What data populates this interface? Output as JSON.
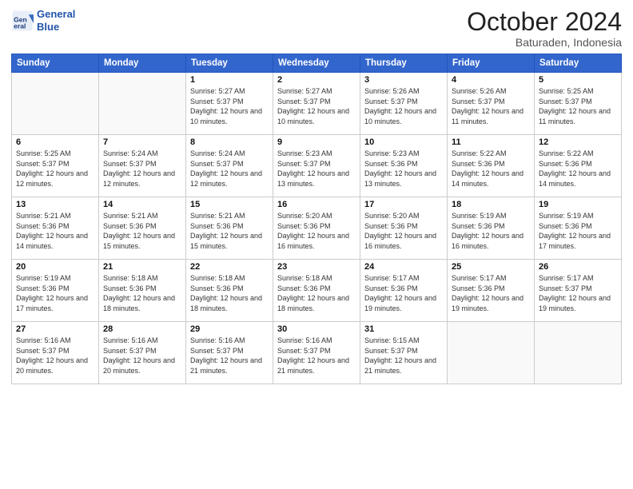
{
  "logo": {
    "line1": "General",
    "line2": "Blue"
  },
  "title": "October 2024",
  "subtitle": "Baturaden, Indonesia",
  "days_header": [
    "Sunday",
    "Monday",
    "Tuesday",
    "Wednesday",
    "Thursday",
    "Friday",
    "Saturday"
  ],
  "weeks": [
    [
      {
        "num": "",
        "info": ""
      },
      {
        "num": "",
        "info": ""
      },
      {
        "num": "1",
        "info": "Sunrise: 5:27 AM\nSunset: 5:37 PM\nDaylight: 12 hours and 10 minutes."
      },
      {
        "num": "2",
        "info": "Sunrise: 5:27 AM\nSunset: 5:37 PM\nDaylight: 12 hours and 10 minutes."
      },
      {
        "num": "3",
        "info": "Sunrise: 5:26 AM\nSunset: 5:37 PM\nDaylight: 12 hours and 10 minutes."
      },
      {
        "num": "4",
        "info": "Sunrise: 5:26 AM\nSunset: 5:37 PM\nDaylight: 12 hours and 11 minutes."
      },
      {
        "num": "5",
        "info": "Sunrise: 5:25 AM\nSunset: 5:37 PM\nDaylight: 12 hours and 11 minutes."
      }
    ],
    [
      {
        "num": "6",
        "info": "Sunrise: 5:25 AM\nSunset: 5:37 PM\nDaylight: 12 hours and 12 minutes."
      },
      {
        "num": "7",
        "info": "Sunrise: 5:24 AM\nSunset: 5:37 PM\nDaylight: 12 hours and 12 minutes."
      },
      {
        "num": "8",
        "info": "Sunrise: 5:24 AM\nSunset: 5:37 PM\nDaylight: 12 hours and 12 minutes."
      },
      {
        "num": "9",
        "info": "Sunrise: 5:23 AM\nSunset: 5:37 PM\nDaylight: 12 hours and 13 minutes."
      },
      {
        "num": "10",
        "info": "Sunrise: 5:23 AM\nSunset: 5:36 PM\nDaylight: 12 hours and 13 minutes."
      },
      {
        "num": "11",
        "info": "Sunrise: 5:22 AM\nSunset: 5:36 PM\nDaylight: 12 hours and 14 minutes."
      },
      {
        "num": "12",
        "info": "Sunrise: 5:22 AM\nSunset: 5:36 PM\nDaylight: 12 hours and 14 minutes."
      }
    ],
    [
      {
        "num": "13",
        "info": "Sunrise: 5:21 AM\nSunset: 5:36 PM\nDaylight: 12 hours and 14 minutes."
      },
      {
        "num": "14",
        "info": "Sunrise: 5:21 AM\nSunset: 5:36 PM\nDaylight: 12 hours and 15 minutes."
      },
      {
        "num": "15",
        "info": "Sunrise: 5:21 AM\nSunset: 5:36 PM\nDaylight: 12 hours and 15 minutes."
      },
      {
        "num": "16",
        "info": "Sunrise: 5:20 AM\nSunset: 5:36 PM\nDaylight: 12 hours and 16 minutes."
      },
      {
        "num": "17",
        "info": "Sunrise: 5:20 AM\nSunset: 5:36 PM\nDaylight: 12 hours and 16 minutes."
      },
      {
        "num": "18",
        "info": "Sunrise: 5:19 AM\nSunset: 5:36 PM\nDaylight: 12 hours and 16 minutes."
      },
      {
        "num": "19",
        "info": "Sunrise: 5:19 AM\nSunset: 5:36 PM\nDaylight: 12 hours and 17 minutes."
      }
    ],
    [
      {
        "num": "20",
        "info": "Sunrise: 5:19 AM\nSunset: 5:36 PM\nDaylight: 12 hours and 17 minutes."
      },
      {
        "num": "21",
        "info": "Sunrise: 5:18 AM\nSunset: 5:36 PM\nDaylight: 12 hours and 18 minutes."
      },
      {
        "num": "22",
        "info": "Sunrise: 5:18 AM\nSunset: 5:36 PM\nDaylight: 12 hours and 18 minutes."
      },
      {
        "num": "23",
        "info": "Sunrise: 5:18 AM\nSunset: 5:36 PM\nDaylight: 12 hours and 18 minutes."
      },
      {
        "num": "24",
        "info": "Sunrise: 5:17 AM\nSunset: 5:36 PM\nDaylight: 12 hours and 19 minutes."
      },
      {
        "num": "25",
        "info": "Sunrise: 5:17 AM\nSunset: 5:36 PM\nDaylight: 12 hours and 19 minutes."
      },
      {
        "num": "26",
        "info": "Sunrise: 5:17 AM\nSunset: 5:37 PM\nDaylight: 12 hours and 19 minutes."
      }
    ],
    [
      {
        "num": "27",
        "info": "Sunrise: 5:16 AM\nSunset: 5:37 PM\nDaylight: 12 hours and 20 minutes."
      },
      {
        "num": "28",
        "info": "Sunrise: 5:16 AM\nSunset: 5:37 PM\nDaylight: 12 hours and 20 minutes."
      },
      {
        "num": "29",
        "info": "Sunrise: 5:16 AM\nSunset: 5:37 PM\nDaylight: 12 hours and 21 minutes."
      },
      {
        "num": "30",
        "info": "Sunrise: 5:16 AM\nSunset: 5:37 PM\nDaylight: 12 hours and 21 minutes."
      },
      {
        "num": "31",
        "info": "Sunrise: 5:15 AM\nSunset: 5:37 PM\nDaylight: 12 hours and 21 minutes."
      },
      {
        "num": "",
        "info": ""
      },
      {
        "num": "",
        "info": ""
      }
    ]
  ]
}
